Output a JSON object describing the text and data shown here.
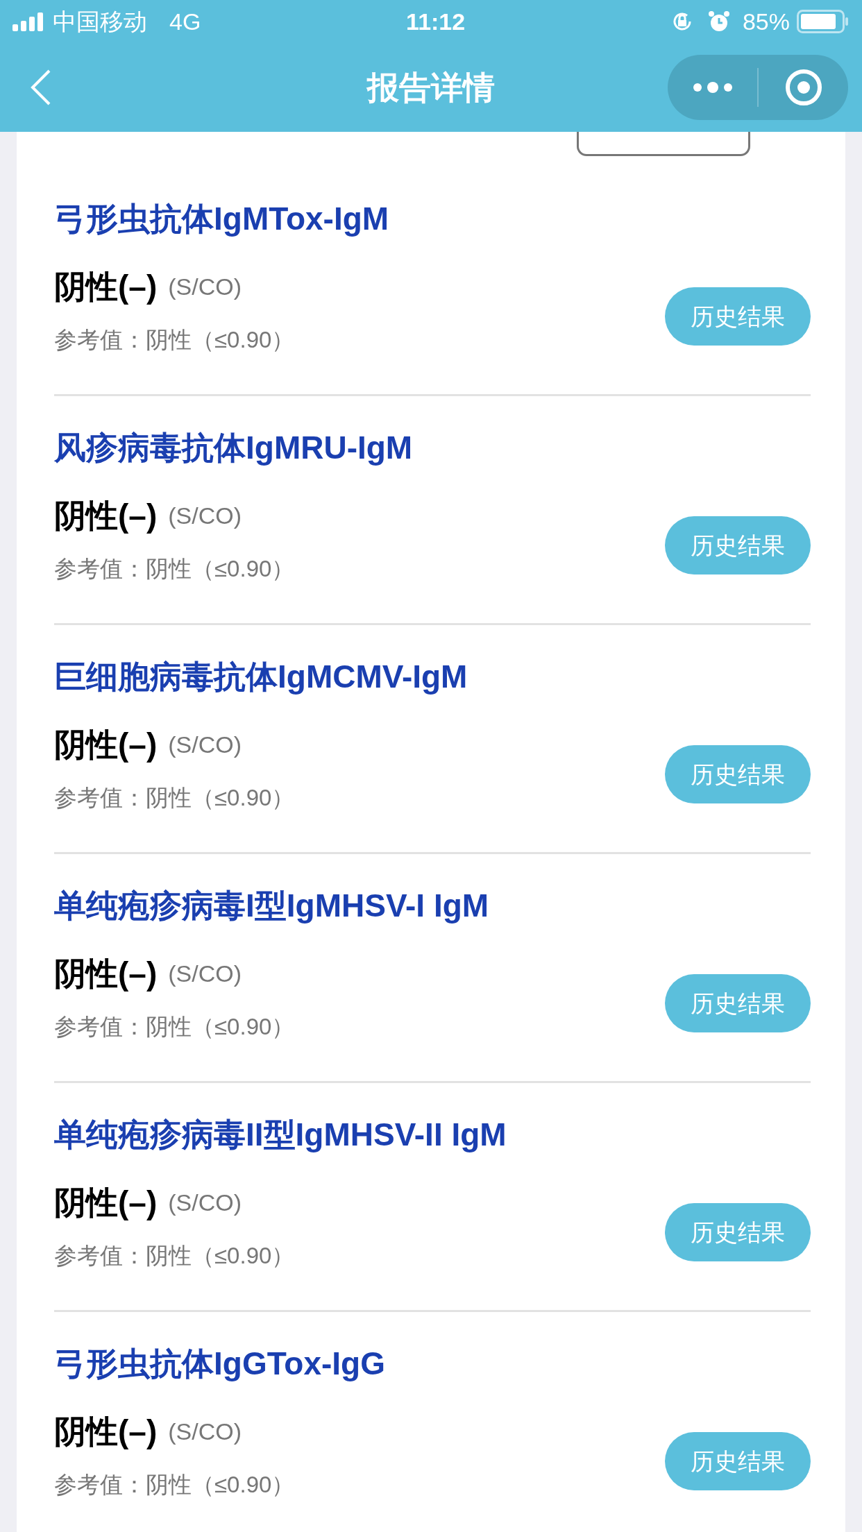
{
  "status_bar": {
    "carrier": "中国移动",
    "network": "4G",
    "time": "11:12",
    "battery": "85%"
  },
  "nav": {
    "title": "报告详情"
  },
  "items": [
    {
      "name": "弓形虫抗体IgMTox-IgM",
      "result": "阴性(–)",
      "unit": "(S/CO)",
      "reference": "参考值：阴性（≤0.90）",
      "button": "历史结果"
    },
    {
      "name": "风疹病毒抗体IgMRU-IgM",
      "result": "阴性(–)",
      "unit": "(S/CO)",
      "reference": "参考值：阴性（≤0.90）",
      "button": "历史结果"
    },
    {
      "name": "巨细胞病毒抗体IgMCMV-IgM",
      "result": "阴性(–)",
      "unit": "(S/CO)",
      "reference": "参考值：阴性（≤0.90）",
      "button": "历史结果"
    },
    {
      "name": "单纯疱疹病毒I型IgMHSV-I IgM",
      "result": "阴性(–)",
      "unit": "(S/CO)",
      "reference": "参考值：阴性（≤0.90）",
      "button": "历史结果"
    },
    {
      "name": "单纯疱疹病毒II型IgMHSV-II IgM",
      "result": "阴性(–)",
      "unit": "(S/CO)",
      "reference": "参考值：阴性（≤0.90）",
      "button": "历史结果"
    },
    {
      "name": "弓形虫抗体IgGTox-IgG",
      "result": "阴性(–)",
      "unit": "(S/CO)",
      "reference": "参考值：阴性（≤0.90）",
      "button": "历史结果"
    }
  ]
}
